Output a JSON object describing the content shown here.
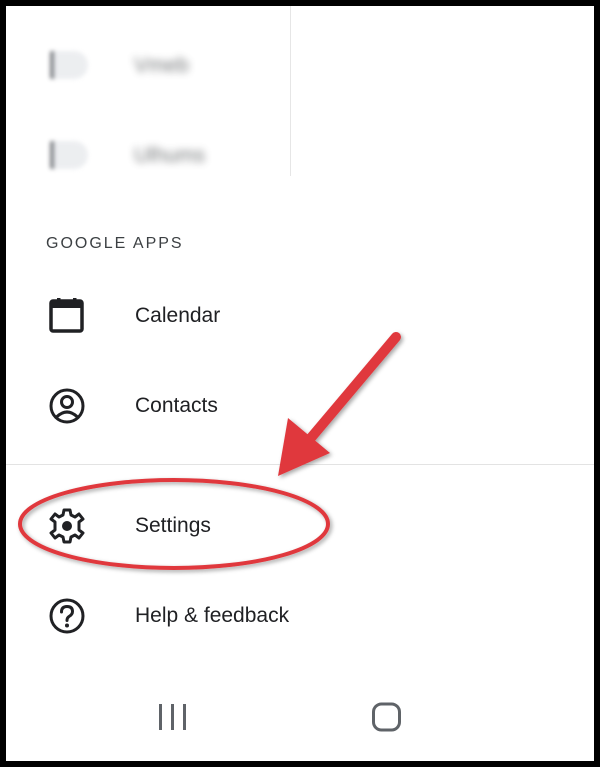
{
  "recent_items": [
    {
      "label": "Vmeb",
      "icon": "label-icon"
    },
    {
      "label": "Ulhums",
      "icon": "label-icon"
    }
  ],
  "google_apps": {
    "header": "GOOGLE APPS",
    "items": [
      {
        "label": "Calendar",
        "icon": "calendar-icon"
      },
      {
        "label": "Contacts",
        "icon": "account-circle-icon"
      }
    ]
  },
  "footer_items": [
    {
      "label": "Settings",
      "icon": "gear-icon"
    },
    {
      "label": "Help & feedback",
      "icon": "help-icon"
    }
  ],
  "system_nav": {
    "recents_icon": "recents-icon",
    "home_icon": "home-icon"
  },
  "annotation": {
    "color": "#e0383e"
  },
  "colors": {
    "icon": "#202124",
    "text": "#202124",
    "divider": "#e3e3e3"
  }
}
